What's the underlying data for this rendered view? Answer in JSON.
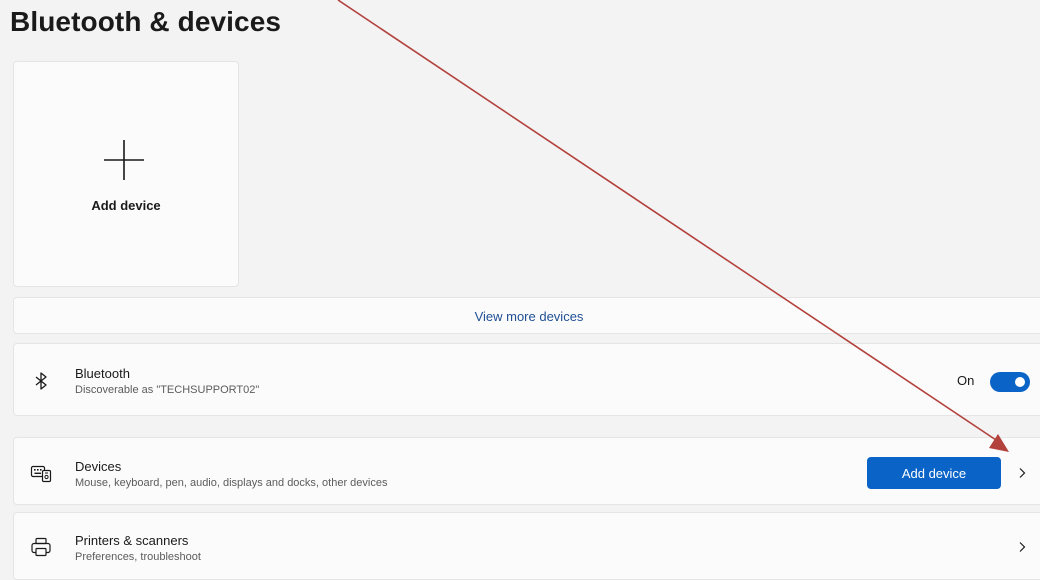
{
  "page": {
    "title": "Bluetooth & devices"
  },
  "add_tile": {
    "label": "Add device",
    "icon": "plus-icon"
  },
  "view_more": {
    "label": "View more devices"
  },
  "bluetooth": {
    "title": "Bluetooth",
    "subtitle": "Discoverable as \"TECHSUPPORT02\"",
    "state_label": "On",
    "toggle_on": true,
    "icon": "bluetooth-icon"
  },
  "devices": {
    "title": "Devices",
    "subtitle": "Mouse, keyboard, pen, audio, displays and docks, other devices",
    "button_label": "Add device",
    "icon": "keyboard-devices-icon"
  },
  "printers": {
    "title": "Printers & scanners",
    "subtitle": "Preferences, troubleshoot",
    "icon": "printer-icon"
  },
  "colors": {
    "accent": "#0a63c6",
    "link": "#1f4f94",
    "annotation_arrow": "#b3413c",
    "background": "#f3f3f3",
    "card": "#fbfbfb"
  }
}
